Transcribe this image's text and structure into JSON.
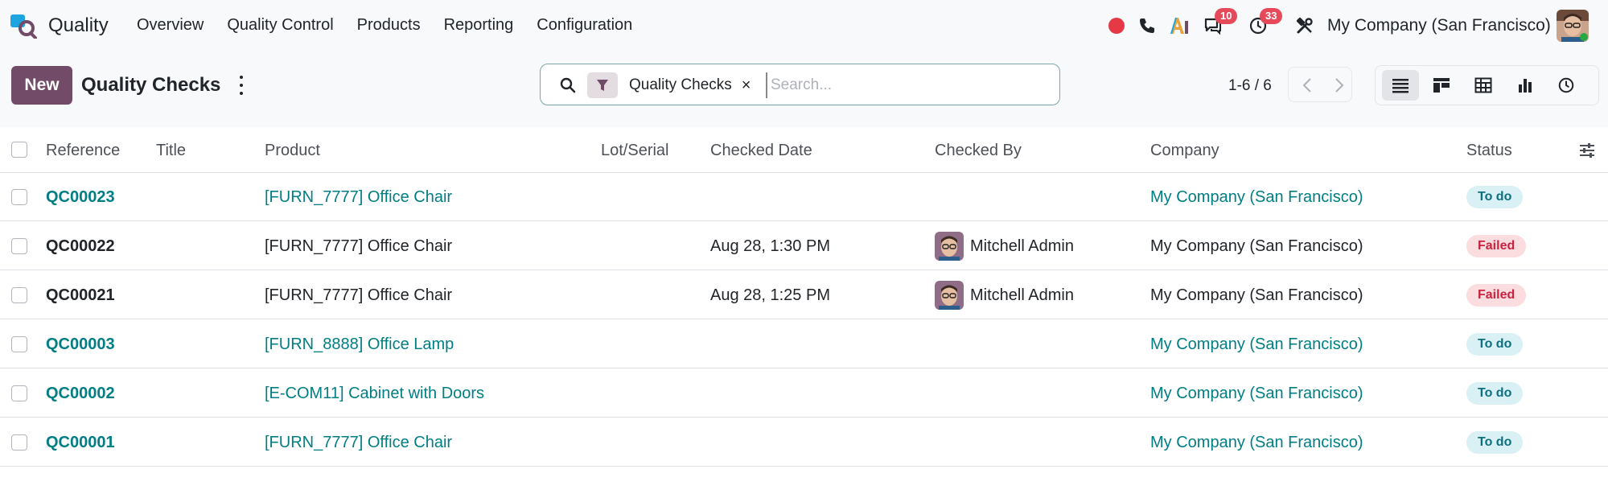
{
  "app": {
    "name": "Quality"
  },
  "nav": {
    "items": [
      "Overview",
      "Quality Control",
      "Products",
      "Reporting",
      "Configuration"
    ]
  },
  "systray": {
    "messages_count": "10",
    "activities_count": "33",
    "company": "My Company (San Francisco)"
  },
  "control_panel": {
    "new_label": "New",
    "title": "Quality Checks",
    "search": {
      "facet_label": "Quality Checks",
      "facet_remove": "×",
      "placeholder": "Search..."
    },
    "pager": "1-6 / 6"
  },
  "table": {
    "columns": [
      "Reference",
      "Title",
      "Product",
      "Lot/Serial",
      "Checked Date",
      "Checked By",
      "Company",
      "Status"
    ],
    "rows": [
      {
        "reference": "QC00023",
        "product": "[FURN_7777] Office Chair",
        "date": "",
        "checked_by": "",
        "company": "My Company (San Francisco)",
        "status": "To do"
      },
      {
        "reference": "QC00022",
        "product": "[FURN_7777] Office Chair",
        "date": "Aug 28, 1:30 PM",
        "checked_by": "Mitchell Admin",
        "company": "My Company (San Francisco)",
        "status": "Failed"
      },
      {
        "reference": "QC00021",
        "product": "[FURN_7777] Office Chair",
        "date": "Aug 28, 1:25 PM",
        "checked_by": "Mitchell Admin",
        "company": "My Company (San Francisco)",
        "status": "Failed"
      },
      {
        "reference": "QC00003",
        "product": "[FURN_8888] Office Lamp",
        "date": "",
        "checked_by": "",
        "company": "My Company (San Francisco)",
        "status": "To do"
      },
      {
        "reference": "QC00002",
        "product": "[E-COM11] Cabinet with Doors",
        "date": "",
        "checked_by": "",
        "company": "My Company (San Francisco)",
        "status": "To do"
      },
      {
        "reference": "QC00001",
        "product": "[FURN_7777] Office Chair",
        "date": "",
        "checked_by": "",
        "company": "My Company (San Francisco)",
        "status": "To do"
      }
    ]
  },
  "colors": {
    "brand": "#714b67",
    "link": "#017e84",
    "todo_bg": "#d9f0f4",
    "failed_bg": "#fbdcdf"
  }
}
